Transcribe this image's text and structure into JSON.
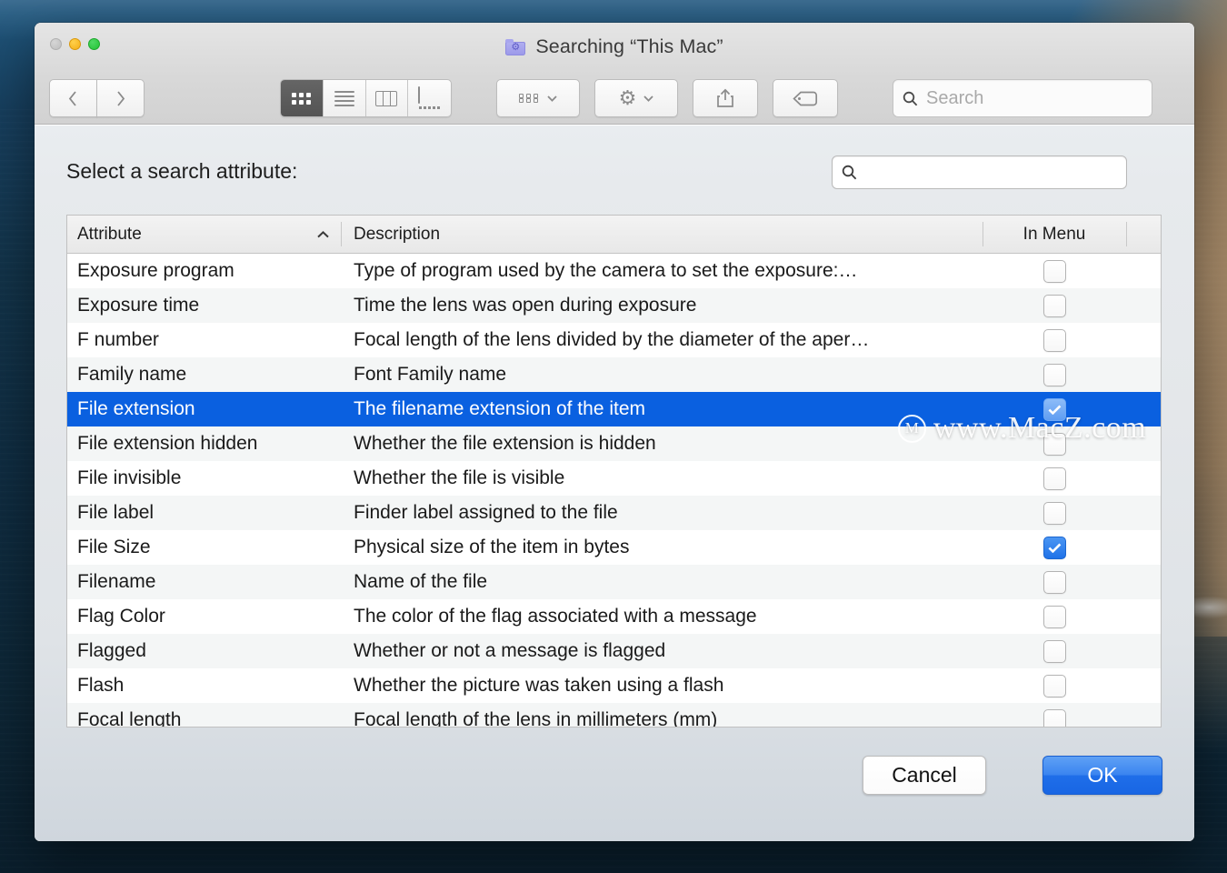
{
  "window": {
    "title": "Searching “This Mac”",
    "folder_icon": "search-folder-icon",
    "traffic_lights": [
      "close-button",
      "minimize-button",
      "zoom-button"
    ]
  },
  "toolbar": {
    "back_label": "back-icon",
    "forward_label": "forward-icon",
    "view_modes": [
      {
        "name": "icon-view",
        "active": true
      },
      {
        "name": "list-view",
        "active": false
      },
      {
        "name": "column-view",
        "active": false
      },
      {
        "name": "cover-flow-view",
        "active": false
      }
    ],
    "arrange_label": "arrange-icon",
    "action_label": "gear-icon",
    "share_label": "share-icon",
    "tags_label": "tag-icon",
    "search": {
      "placeholder": "Search",
      "value": ""
    }
  },
  "sheet": {
    "prompt": "Select a search attribute:",
    "search": {
      "placeholder": "",
      "value": ""
    },
    "columns": {
      "attribute": "Attribute",
      "description": "Description",
      "in_menu": "In Menu"
    },
    "sort": {
      "column": "Attribute",
      "direction": "ascending"
    },
    "rows": [
      {
        "attribute": "Exposure program",
        "description": "Type of program used by the camera to set the exposure:…",
        "in_menu": false,
        "selected": false
      },
      {
        "attribute": "Exposure time",
        "description": "Time the lens was open during exposure",
        "in_menu": false,
        "selected": false
      },
      {
        "attribute": "F number",
        "description": "Focal length of the lens divided by the diameter of the aper…",
        "in_menu": false,
        "selected": false
      },
      {
        "attribute": "Family name",
        "description": "Font Family name",
        "in_menu": false,
        "selected": false
      },
      {
        "attribute": "File extension",
        "description": "The filename extension of the item",
        "in_menu": true,
        "selected": true
      },
      {
        "attribute": "File extension hidden",
        "description": "Whether the file extension is hidden",
        "in_menu": false,
        "selected": false
      },
      {
        "attribute": "File invisible",
        "description": "Whether the file is visible",
        "in_menu": false,
        "selected": false
      },
      {
        "attribute": "File label",
        "description": "Finder label assigned to the file",
        "in_menu": false,
        "selected": false
      },
      {
        "attribute": "File Size",
        "description": "Physical size of the item in bytes",
        "in_menu": true,
        "selected": false
      },
      {
        "attribute": "Filename",
        "description": "Name of the file",
        "in_menu": false,
        "selected": false
      },
      {
        "attribute": "Flag Color",
        "description": "The color of the flag associated with a message",
        "in_menu": false,
        "selected": false
      },
      {
        "attribute": "Flagged",
        "description": "Whether or not a message is flagged",
        "in_menu": false,
        "selected": false
      },
      {
        "attribute": "Flash",
        "description": "Whether the picture was taken using a flash",
        "in_menu": false,
        "selected": false
      },
      {
        "attribute": "Focal length",
        "description": "Focal length of the lens in millimeters (mm)",
        "in_menu": false,
        "selected": false
      }
    ],
    "cancel_label": "Cancel",
    "ok_label": "OK"
  },
  "watermark": {
    "logo": "M",
    "text": "www.MacZ.com"
  },
  "colors": {
    "selection_blue": "#0a60e0",
    "checkbox_blue": "#1f72e8",
    "ok_button_blue": "#1f6ee9"
  }
}
